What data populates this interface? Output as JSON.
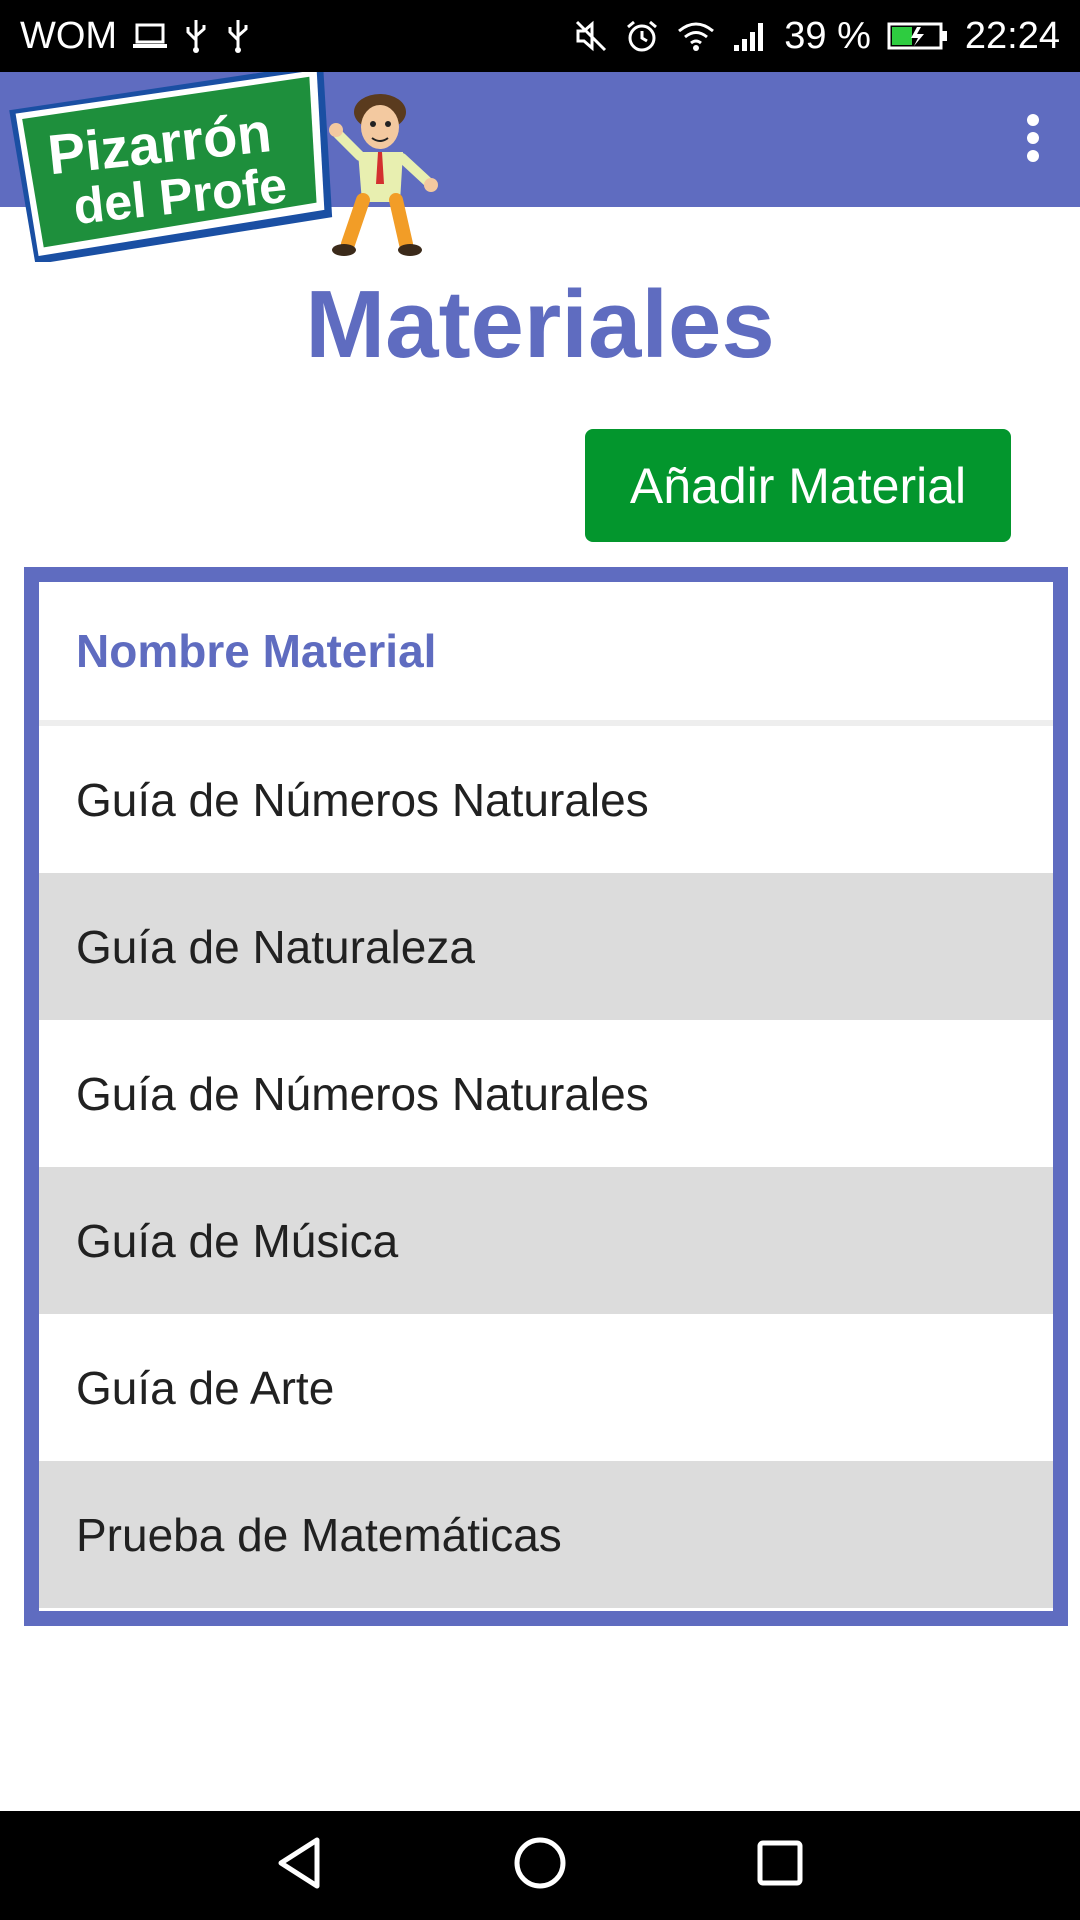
{
  "status_bar": {
    "carrier": "WOM",
    "battery_percent": "39 %",
    "time": "22:24",
    "icons": [
      "laptop-icon",
      "usb-icon",
      "usb-icon",
      "mute-icon",
      "alarm-icon",
      "wifi-icon",
      "signal-icon",
      "battery-charging-icon"
    ]
  },
  "app_bar": {
    "logo_text_line1": "Pizarrón",
    "logo_text_line2": "del Profe",
    "menu_icon": "more-vert-icon",
    "bar_color": "#5f6cc0"
  },
  "page": {
    "title": "Materiales",
    "add_button_label": "Añadir Material",
    "add_button_color": "#03962d"
  },
  "table": {
    "header": "Nombre Material",
    "rows": [
      "Guía de Números Naturales",
      "Guía de Naturaleza",
      "Guía de Números Naturales",
      "Guía de Música",
      "Guía de Arte",
      "Prueba de Matemáticas"
    ]
  },
  "nav_bar": {
    "buttons": [
      "back-icon",
      "home-icon",
      "recents-icon"
    ]
  }
}
